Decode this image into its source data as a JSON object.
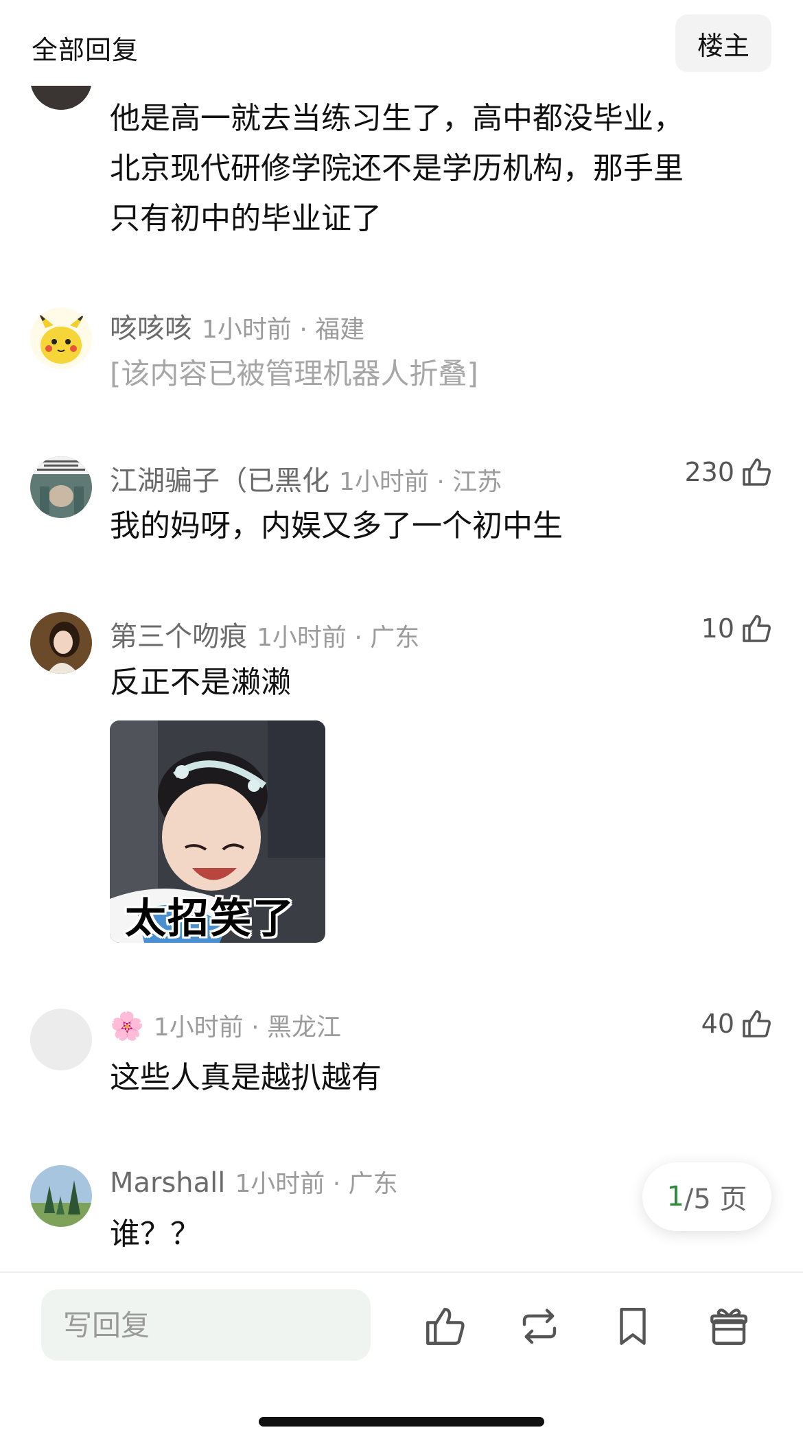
{
  "header": {
    "title": "全部回复",
    "op_button": "楼主"
  },
  "comments": [
    {
      "text_lines": [
        "他是高一就去当练习生了，高中都没毕业，",
        "北京现代研修学院还不是学历机构，那手里",
        "只有初中的毕业证了"
      ]
    },
    {
      "username": "咳咳咳",
      "time_location": "1小时前 · 福建",
      "text": "[该内容已被管理机器人折叠]"
    },
    {
      "username": "江湖骗子（已黑化",
      "time_location": "1小时前 · 江苏",
      "likes": "230",
      "text": "我的妈呀，内娱又多了一个初中生"
    },
    {
      "username": "第三个吻痕",
      "time_location": "1小时前 · 广东",
      "likes": "10",
      "text": "反正不是濑濑",
      "sticker_caption": "太招笑了"
    },
    {
      "username": "🌸",
      "time_location": "1小时前 · 黑龙江",
      "likes": "40",
      "text": "这些人真是越扒越有"
    },
    {
      "username": "Marshall",
      "time_location": "1小时前 · 广东",
      "text": "谁？？"
    }
  ],
  "pagination": {
    "current": "1",
    "total_suffix": "/5 页"
  },
  "bottom_bar": {
    "reply_placeholder": "写回复"
  },
  "colors": {
    "accent_green": "#2e8b3e",
    "input_bg": "#eff4f0"
  },
  "icons": [
    "thumbs-up-icon",
    "repost-icon",
    "bookmark-icon",
    "gift-icon"
  ]
}
